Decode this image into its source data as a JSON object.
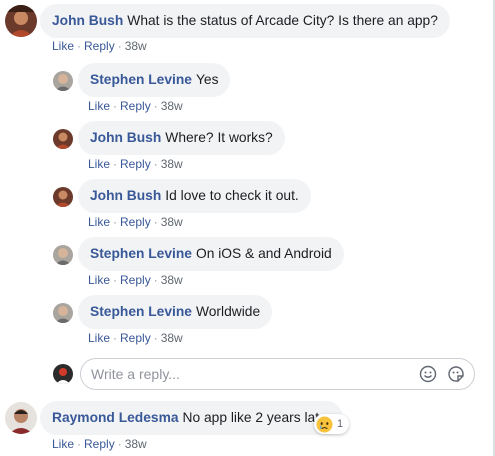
{
  "actions": {
    "like": "Like",
    "reply": "Reply",
    "separator": "·"
  },
  "comments": [
    {
      "author": "John Bush",
      "text": "What is the status of Arcade City? Is there an app?",
      "time": "38w"
    },
    {
      "author": "Raymond Ledesma",
      "text": "No app like 2 years later",
      "time": "38w",
      "reaction": {
        "icon": "sad-face-icon",
        "count": "1"
      }
    }
  ],
  "replies": [
    {
      "author": "Stephen Levine",
      "text": "Yes",
      "time": "38w"
    },
    {
      "author": "John Bush",
      "text": "Where? It works?",
      "time": "38w"
    },
    {
      "author": "John Bush",
      "text": "Id love to check it out.",
      "time": "38w"
    },
    {
      "author": "Stephen Levine",
      "text": "On iOS & and Android",
      "time": "38w"
    },
    {
      "author": "Stephen Levine",
      "text": "Worldwide",
      "time": "38w"
    }
  ],
  "reply_box": {
    "placeholder": "Write a reply...",
    "icons": [
      "emoji-icon",
      "sticker-icon"
    ]
  },
  "colors": {
    "name_link": "#385898",
    "bubble_bg": "#f2f3f5",
    "meta_text": "#606770"
  }
}
